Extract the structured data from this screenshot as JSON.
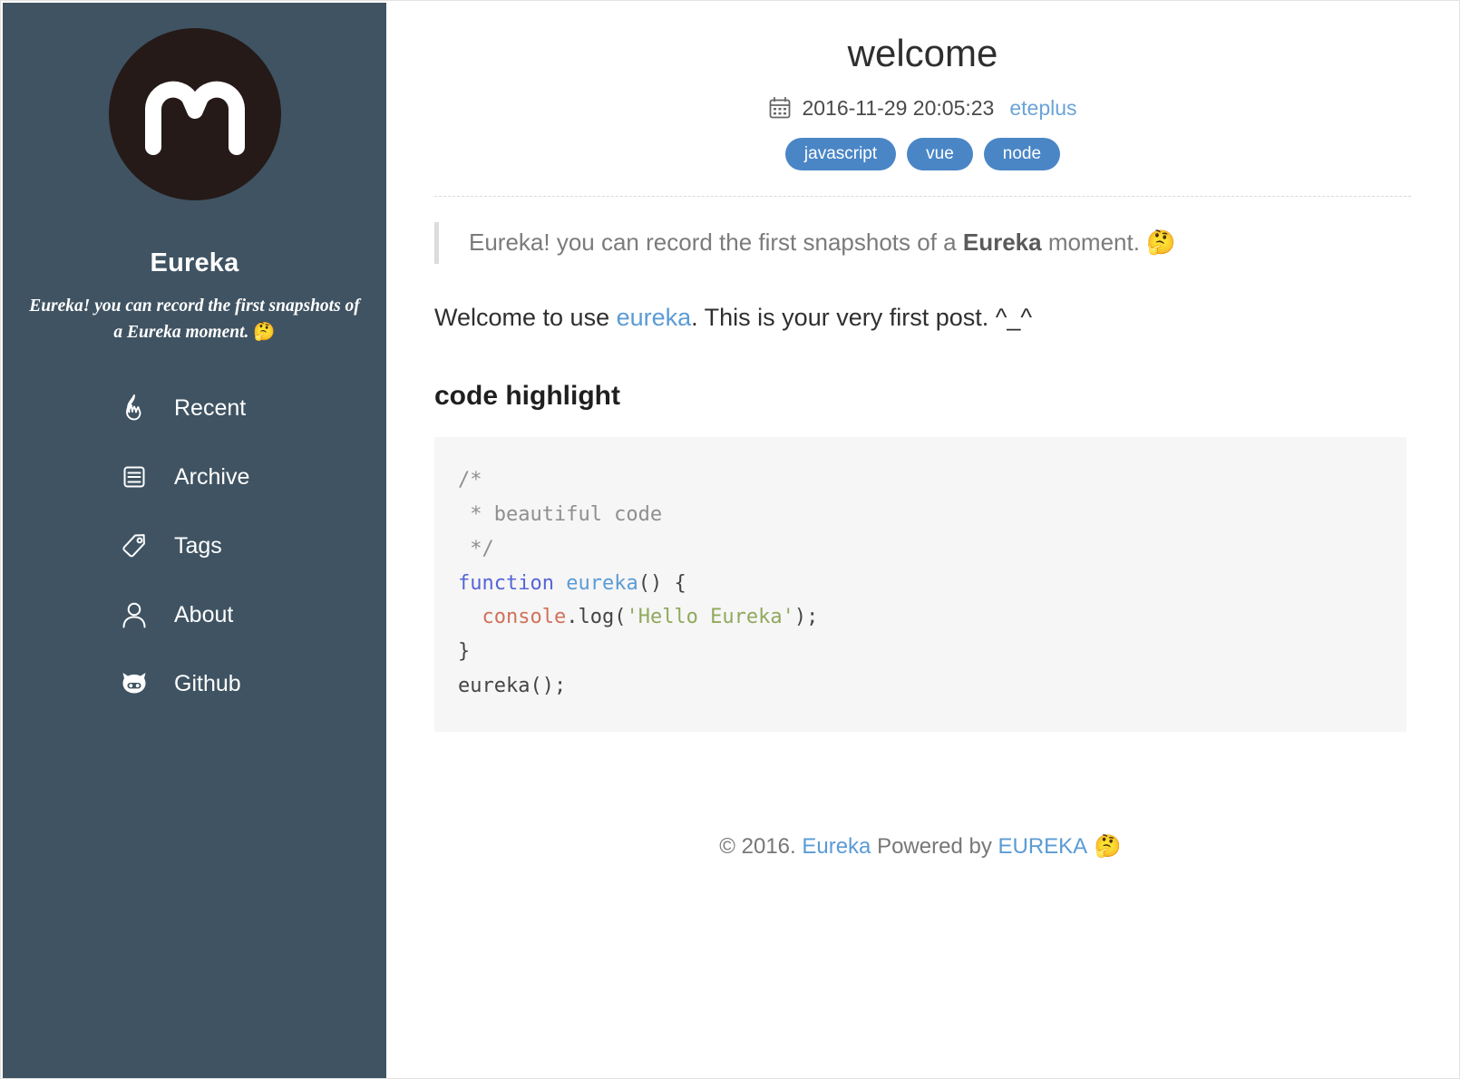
{
  "sidebar": {
    "logo_icon": "eureka-m-logo-icon",
    "title": "Eureka",
    "subtitle": "Eureka! you can record the first snapshots of a Eureka moment.",
    "subtitle_emoji": "🤔",
    "nav": [
      {
        "label": "Recent",
        "icon": "flame-icon"
      },
      {
        "label": "Archive",
        "icon": "archive-drawer-icon"
      },
      {
        "label": "Tags",
        "icon": "tag-icon"
      },
      {
        "label": "About",
        "icon": "user-icon"
      },
      {
        "label": "Github",
        "icon": "github-octocat-icon"
      }
    ],
    "bg_color": "#3f5362",
    "logo_bg_color": "#251a18"
  },
  "post": {
    "title": "welcome",
    "date_icon": "calendar-icon",
    "date": "2016-11-29 20:05:23",
    "author": "eteplus",
    "tags": [
      "javascript",
      "vue",
      "node"
    ],
    "tag_color": "#4a86c6",
    "link_color": "#5b9bd5",
    "quote": {
      "lead": "Eureka! you can record the first snapshots of a ",
      "bold": "Eureka",
      "tail": " moment. ",
      "emoji": "🤔"
    },
    "paragraph": {
      "before_link": "Welcome to use ",
      "link": "eureka",
      "after_link": ". This is your very first post. ^_^"
    },
    "section_heading": "code highlight",
    "code": {
      "language": "javascript",
      "lines": [
        [
          {
            "t": "/*",
            "c": "comment"
          }
        ],
        [
          {
            "t": " * beautiful code",
            "c": "comment"
          }
        ],
        [
          {
            "t": " */",
            "c": "comment"
          }
        ],
        [
          {
            "t": "function ",
            "c": "keyword"
          },
          {
            "t": "eureka",
            "c": "fnname"
          },
          {
            "t": "() {",
            "c": "plain"
          }
        ],
        [
          {
            "t": "  ",
            "c": "plain"
          },
          {
            "t": "console",
            "c": "builtin"
          },
          {
            "t": ".log(",
            "c": "plain"
          },
          {
            "t": "'Hello Eureka'",
            "c": "string"
          },
          {
            "t": ");",
            "c": "plain"
          }
        ],
        [
          {
            "t": "}",
            "c": "plain"
          }
        ],
        [
          {
            "t": "eureka();",
            "c": "plain"
          }
        ]
      ],
      "bg_color": "#f6f6f6"
    }
  },
  "footer": {
    "copyright": "© 2016. ",
    "site_link": "Eureka",
    "powered_by": " Powered by ",
    "engine_link": "EUREKA",
    "emoji": " 🤔"
  }
}
